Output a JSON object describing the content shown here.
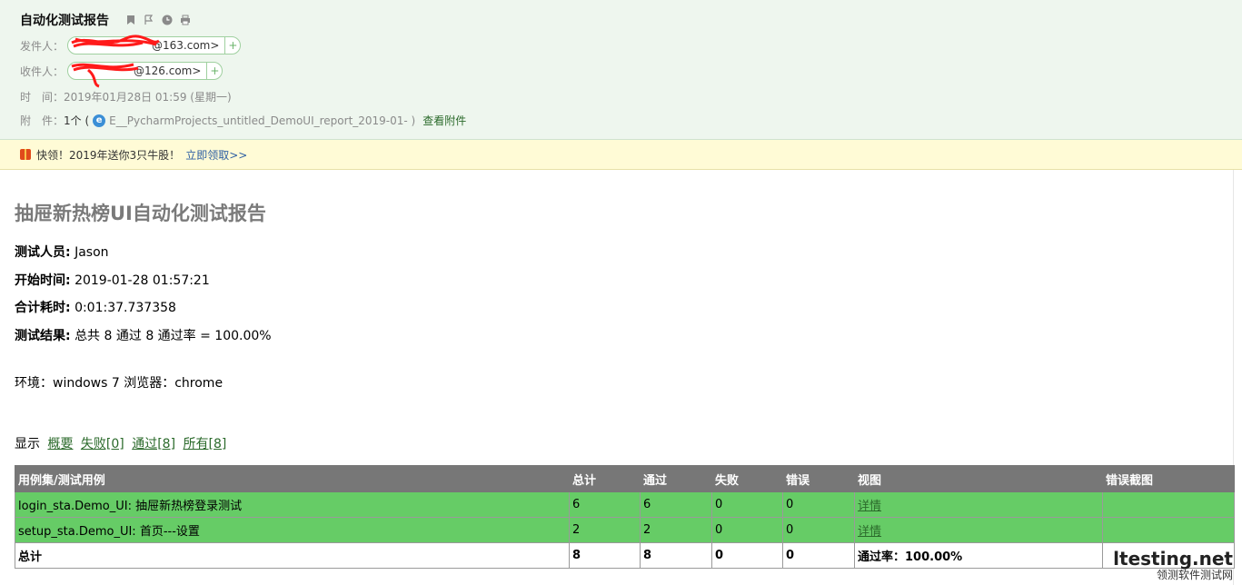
{
  "mail": {
    "subject": "自动化测试报告",
    "sender_label": "发件人：",
    "sender_address": "@163.com>",
    "recipient_label": "收件人：",
    "recipient_address": "@126.com>",
    "time_label": "时　间：",
    "time_value": "2019年01月28日 01:59 (星期一)",
    "attachment_label": "附　件：",
    "attachment_count": "1个 (",
    "attachment_name": "E__PycharmProjects_untitled_DemoUI_report_2019-01- )",
    "view_attachment": "查看附件"
  },
  "promo": {
    "text": "快领！2019年送你3只牛股！",
    "link": "立即领取>>"
  },
  "report": {
    "title": "抽屉新热榜UI自动化测试报告",
    "tester_label": "测试人员:",
    "tester_value": "Jason",
    "start_label": "开始时间:",
    "start_value": "2019-01-28 01:57:21",
    "duration_label": "合计耗时:",
    "duration_value": "0:01:37.737358",
    "result_label": "测试结果:",
    "result_value": "总共 8 通过 8 通过率 = 100.00%",
    "environment": "环境：windows 7 浏览器：chrome",
    "show_label": "显示",
    "filters": [
      "概要",
      "失败[0]",
      "通过[8]",
      "所有[8]"
    ]
  },
  "table": {
    "headers": [
      "用例集/测试用例",
      "总计",
      "通过",
      "失败",
      "错误",
      "视图",
      "错误截图"
    ],
    "rows": [
      [
        "login_sta.Demo_UI: 抽屉新热榜登录测试",
        "6",
        "6",
        "0",
        "0",
        "详情",
        ""
      ],
      [
        "setup_sta.Demo_UI: 首页---设置",
        "2",
        "2",
        "0",
        "0",
        "详情",
        ""
      ]
    ],
    "total_row": [
      "总计",
      "8",
      "8",
      "0",
      "0",
      "通过率：100.00%",
      ""
    ]
  },
  "watermark": {
    "top": "ltesting.net",
    "bottom": "领测软件测试网"
  },
  "colors": {
    "header_bg": "#eef6ee",
    "promo_bg": "#fffbd6",
    "table_header": "#777777",
    "pass_row": "#66cc66",
    "link_green": "#2b6a2b"
  }
}
